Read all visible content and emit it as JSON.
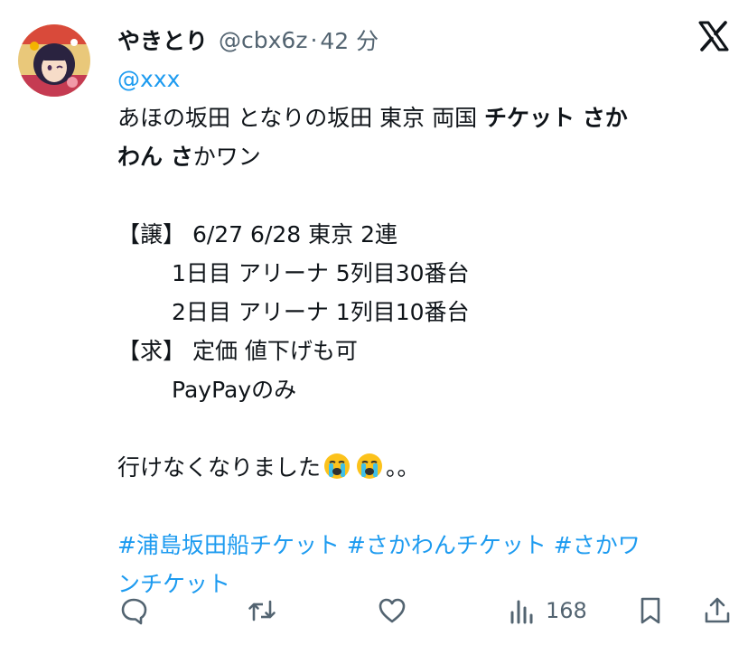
{
  "tweet": {
    "display_name": "やきとり",
    "handle": "@cbx6z",
    "separator": "·",
    "time": "42 分",
    "mention": "@xxx",
    "line1": "あほの坂田 となりの坂田 東京 両国 ",
    "line1_bold": "チケット さか",
    "line2_bold": "わん さ",
    "line2_rest": "かワン",
    "offer": "【譲】 6/27 6/28 東京 2連",
    "day1": "1日目 アリーナ 5列目30番台",
    "day2": "2日目 アリーナ 1列目10番台",
    "want": "【求】 定価 値下げも可",
    "paypay": "PayPayのみ",
    "closing_text": "行けなくなりました",
    "closing_end": "。。",
    "hashtags_line1": "#浦島坂田船チケット #さかわんチケット #さかワ",
    "hashtags_line2": "ンチケット"
  },
  "actions": {
    "views_count": "168"
  },
  "icons": {
    "platform_logo": "x-logo-icon",
    "reply": "reply-icon",
    "retweet": "retweet-icon",
    "like": "heart-icon",
    "views": "views-icon",
    "bookmark": "bookmark-icon",
    "share": "share-icon",
    "emoji": "loudly-crying-face-emoji"
  },
  "colors": {
    "link": "#1d9bf0",
    "secondary_text": "#536471",
    "primary_text": "#0f1419"
  }
}
